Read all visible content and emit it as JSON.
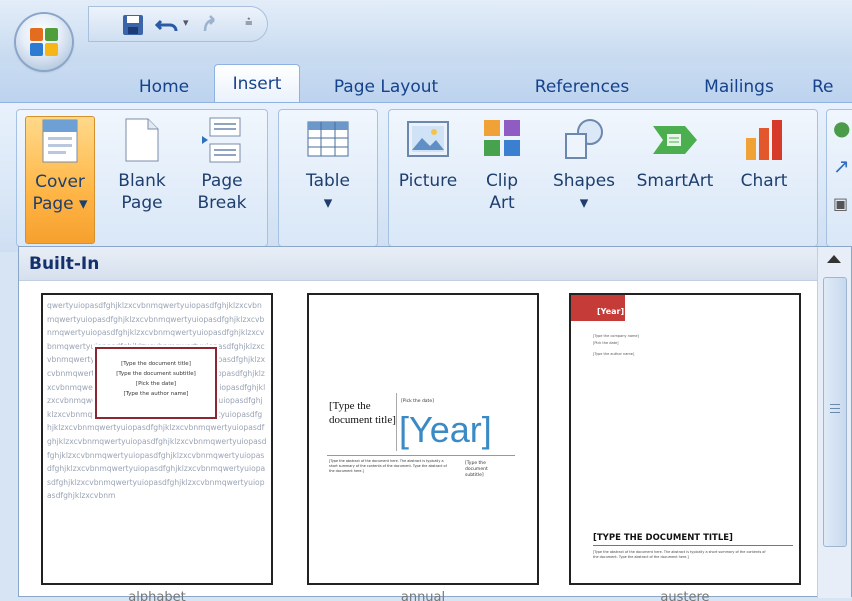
{
  "tabs": [
    {
      "label": "Home"
    },
    {
      "label": "Insert"
    },
    {
      "label": "Page Layout"
    },
    {
      "label": "References"
    },
    {
      "label": "Mailings"
    },
    {
      "label": "Re"
    }
  ],
  "ribbon": {
    "buttons": [
      {
        "label_line1": "Cover",
        "label_line2": "Page ▾",
        "icon": "cover-page-icon"
      },
      {
        "label_line1": "Blank",
        "label_line2": "Page",
        "icon": "blank-page-icon"
      },
      {
        "label_line1": "Page",
        "label_line2": "Break",
        "icon": "page-break-icon"
      },
      {
        "label_line1": "Table",
        "label_line2": "▾",
        "icon": "table-icon"
      },
      {
        "label_line1": "Picture",
        "label_line2": "",
        "icon": "picture-icon"
      },
      {
        "label_line1": "Clip",
        "label_line2": "Art",
        "icon": "clip-art-icon"
      },
      {
        "label_line1": "Shapes",
        "label_line2": "▾",
        "icon": "shapes-icon"
      },
      {
        "label_line1": "SmartArt",
        "label_line2": "",
        "icon": "smartart-icon"
      },
      {
        "label_line1": "Chart",
        "label_line2": "",
        "icon": "chart-icon"
      }
    ]
  },
  "gallery": {
    "header": "Built-In",
    "thumbnails": [
      {
        "name": "alphabet",
        "filler": "qwertyuiopasdfghjklzxcvbnmqwertyuiopasdfghjklzxcvbnmqwertyuiopasdfghjklzxcvbnmqwertyuiopasdfghjklzxcvbnmqwertyuiopasdfghjklzxcvbnmqwertyuiopasdfghjklzxcvbnmqwertyuiopasdfghjklzxcvbnmqwertyuiopasdfghjklzxcvbnmqwertyuiopasdfghjklzxcvbnmqwertyuiopasdfghjklzxcvbnmqwertyuiopasdfghjklzxcvbnmqwertyuiopasdfghjklzxcvbnmqwertyuiopasdfghjklzxcvbnmqwertyuiopasdfghjklzxcvbnmqwertyuiopasdfghjklzxcvbnmqwertyuiopasdfghjklzxcvbnmqwertyuiopasdfghjklzxcvbnmqwertyuiopasdfghjklzxcvbnmqwertyuiopasdfghjklzxcvbnmqwertyuiopasdfghjklzxcvbnmqwertyuiopasdfghjklzxcvbnmqwertyuiopasdfghjklzxcvbnmqwertyuiopasdfghjklzxcvbnmqwertyuiopasdfghjklzxcvbnmqwertyuiopasdfghjklzxcvbnmqwertyuiopasdfghjklzxcvbnmqwertyuiopasdfghjklzxcvbnmqwertyuiopasdfghjklzxcvbnm",
        "box_title": "[Type the document title]",
        "box_subtitle": "[Type the document subtitle]",
        "box_year": "[Pick the date]",
        "box_author": "[Type the author name]"
      },
      {
        "name": "annual",
        "title": "[Type the document title]",
        "pub": "[Pick the date]",
        "year": "[Year]",
        "body": "[Type the abstract of the document here. The abstract is typically a short summary of the contents of the document. Type the abstract of the document here.]",
        "subtitle": "[Type the document subtitle]"
      },
      {
        "name": "austere",
        "year": "[Year]",
        "small1": "[Type the company name]",
        "small2": "[Pick the date]",
        "small3": "[Type the author name]",
        "title": "[TYPE THE DOCUMENT TITLE]",
        "body": "[Type the abstract of the document here. The abstract is typically a short summary of the contents of the document. Type the abstract of the document here.]"
      }
    ]
  },
  "colors": {
    "accent": "#ffb646",
    "year_blue": "#3a8ac6",
    "austere_red": "#c43b38"
  }
}
